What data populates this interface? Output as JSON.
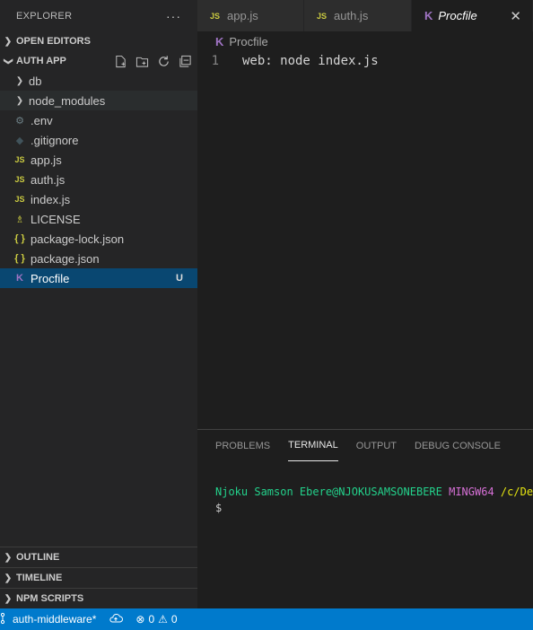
{
  "sidebar": {
    "title": "EXPLORER",
    "more": "···",
    "open_editors": "OPEN EDITORS",
    "project": "AUTH APP",
    "tree": [
      {
        "label": "db",
        "kind": "folder"
      },
      {
        "label": "node_modules",
        "kind": "folder"
      },
      {
        "label": ".env",
        "kind": "gear"
      },
      {
        "label": ".gitignore",
        "kind": "git"
      },
      {
        "label": "app.js",
        "kind": "js"
      },
      {
        "label": "auth.js",
        "kind": "js"
      },
      {
        "label": "index.js",
        "kind": "js"
      },
      {
        "label": "LICENSE",
        "kind": "license"
      },
      {
        "label": "package-lock.json",
        "kind": "json"
      },
      {
        "label": "package.json",
        "kind": "json"
      },
      {
        "label": "Procfile",
        "kind": "procfile",
        "badge": "U"
      }
    ],
    "outline": "OUTLINE",
    "timeline": "TIMELINE",
    "npm_scripts": "NPM SCRIPTS"
  },
  "tabs": [
    {
      "label": "app.js",
      "icon": "JS"
    },
    {
      "label": "auth.js",
      "icon": "JS"
    },
    {
      "label": "Procfile",
      "icon": "K",
      "close": "✕"
    }
  ],
  "breadcrumb": "Procfile",
  "editor": {
    "lines": [
      {
        "num": "1",
        "text": "web: node index.js"
      }
    ]
  },
  "panel": {
    "tabs": [
      "PROBLEMS",
      "TERMINAL",
      "OUTPUT",
      "DEBUG CONSOLE"
    ],
    "terminal": {
      "user": "Njoku Samson Ebere@NJOKUSAMSONEBERE",
      "env": "MINGW64",
      "path": "/c/Dev",
      "prompt": "$"
    }
  },
  "status": {
    "branch": "auth-middleware*",
    "errors": "0",
    "warnings": "0"
  },
  "colors": {
    "statusbar": "#007acc",
    "selection": "#094771",
    "sidebar": "#252526",
    "editor": "#1e1e1e"
  }
}
